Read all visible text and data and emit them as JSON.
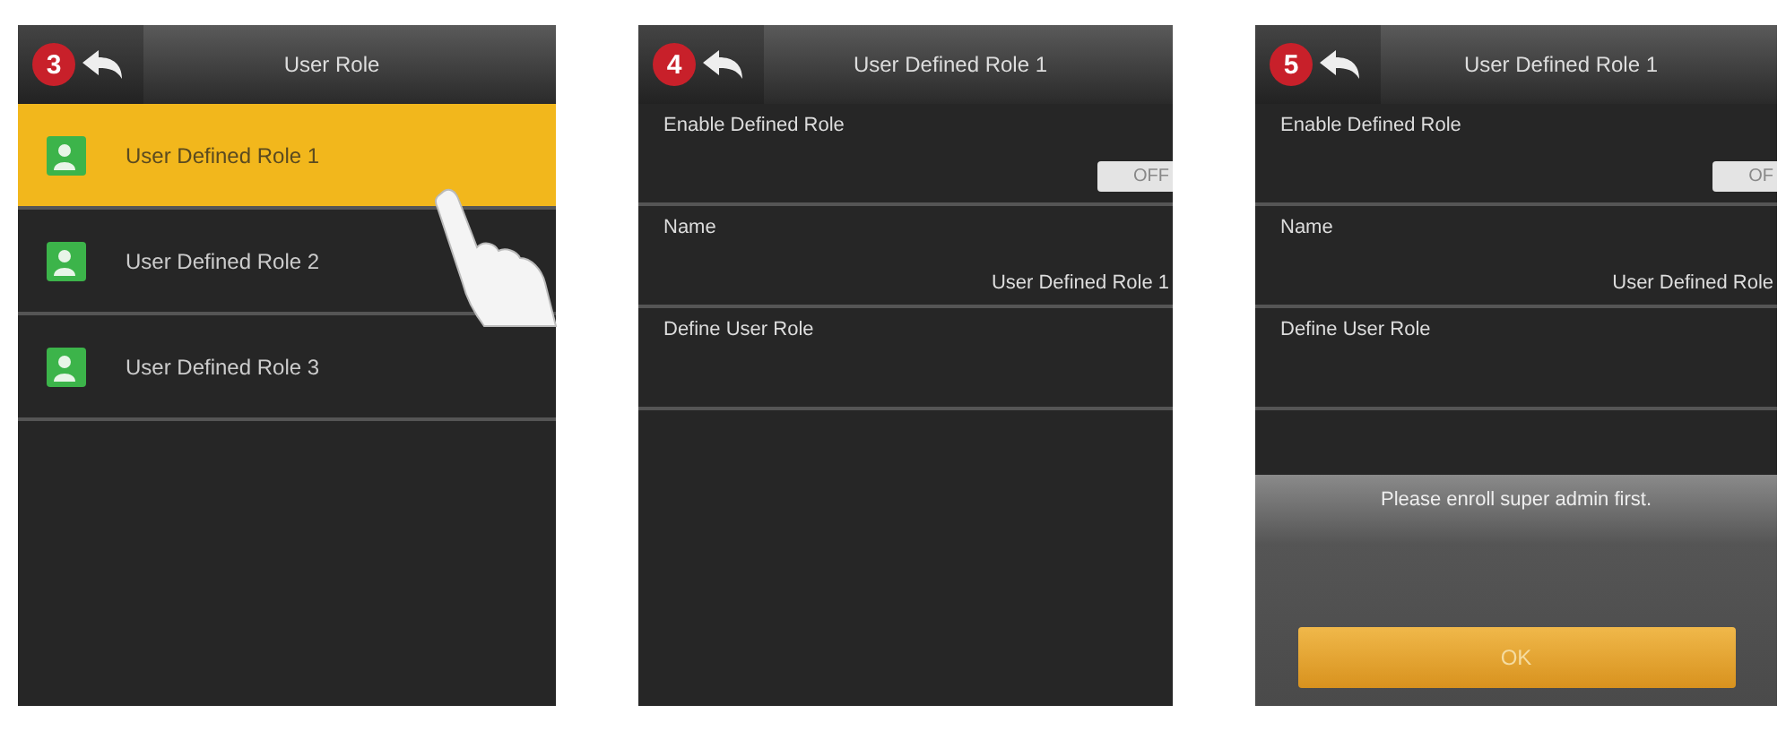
{
  "screens": [
    {
      "step": "3",
      "title": "User Role",
      "kind": "list",
      "items": [
        {
          "label": "User Defined Role 1",
          "selected": true
        },
        {
          "label": "User Defined Role 2",
          "selected": false
        },
        {
          "label": "User Defined Role 3",
          "selected": false
        }
      ]
    },
    {
      "step": "4",
      "title": "User Defined Role 1",
      "kind": "settings",
      "settings": [
        {
          "kind": "toggle",
          "label": "Enable Defined Role",
          "value": "OFF",
          "on": false
        },
        {
          "kind": "value",
          "label": "Name",
          "value": "User Defined Role 1"
        },
        {
          "kind": "link",
          "label": "Define User Role"
        }
      ]
    },
    {
      "step": "5",
      "title": "User Defined Role 1",
      "kind": "settings",
      "settings": [
        {
          "kind": "toggle",
          "label": "Enable Defined Role",
          "value": "OF",
          "on": false
        },
        {
          "kind": "value",
          "label": "Name",
          "value": "User Defined Role"
        },
        {
          "kind": "link",
          "label": "Define User Role"
        }
      ],
      "dialog": {
        "message": "Please enroll super admin first.",
        "button": "OK"
      }
    }
  ]
}
